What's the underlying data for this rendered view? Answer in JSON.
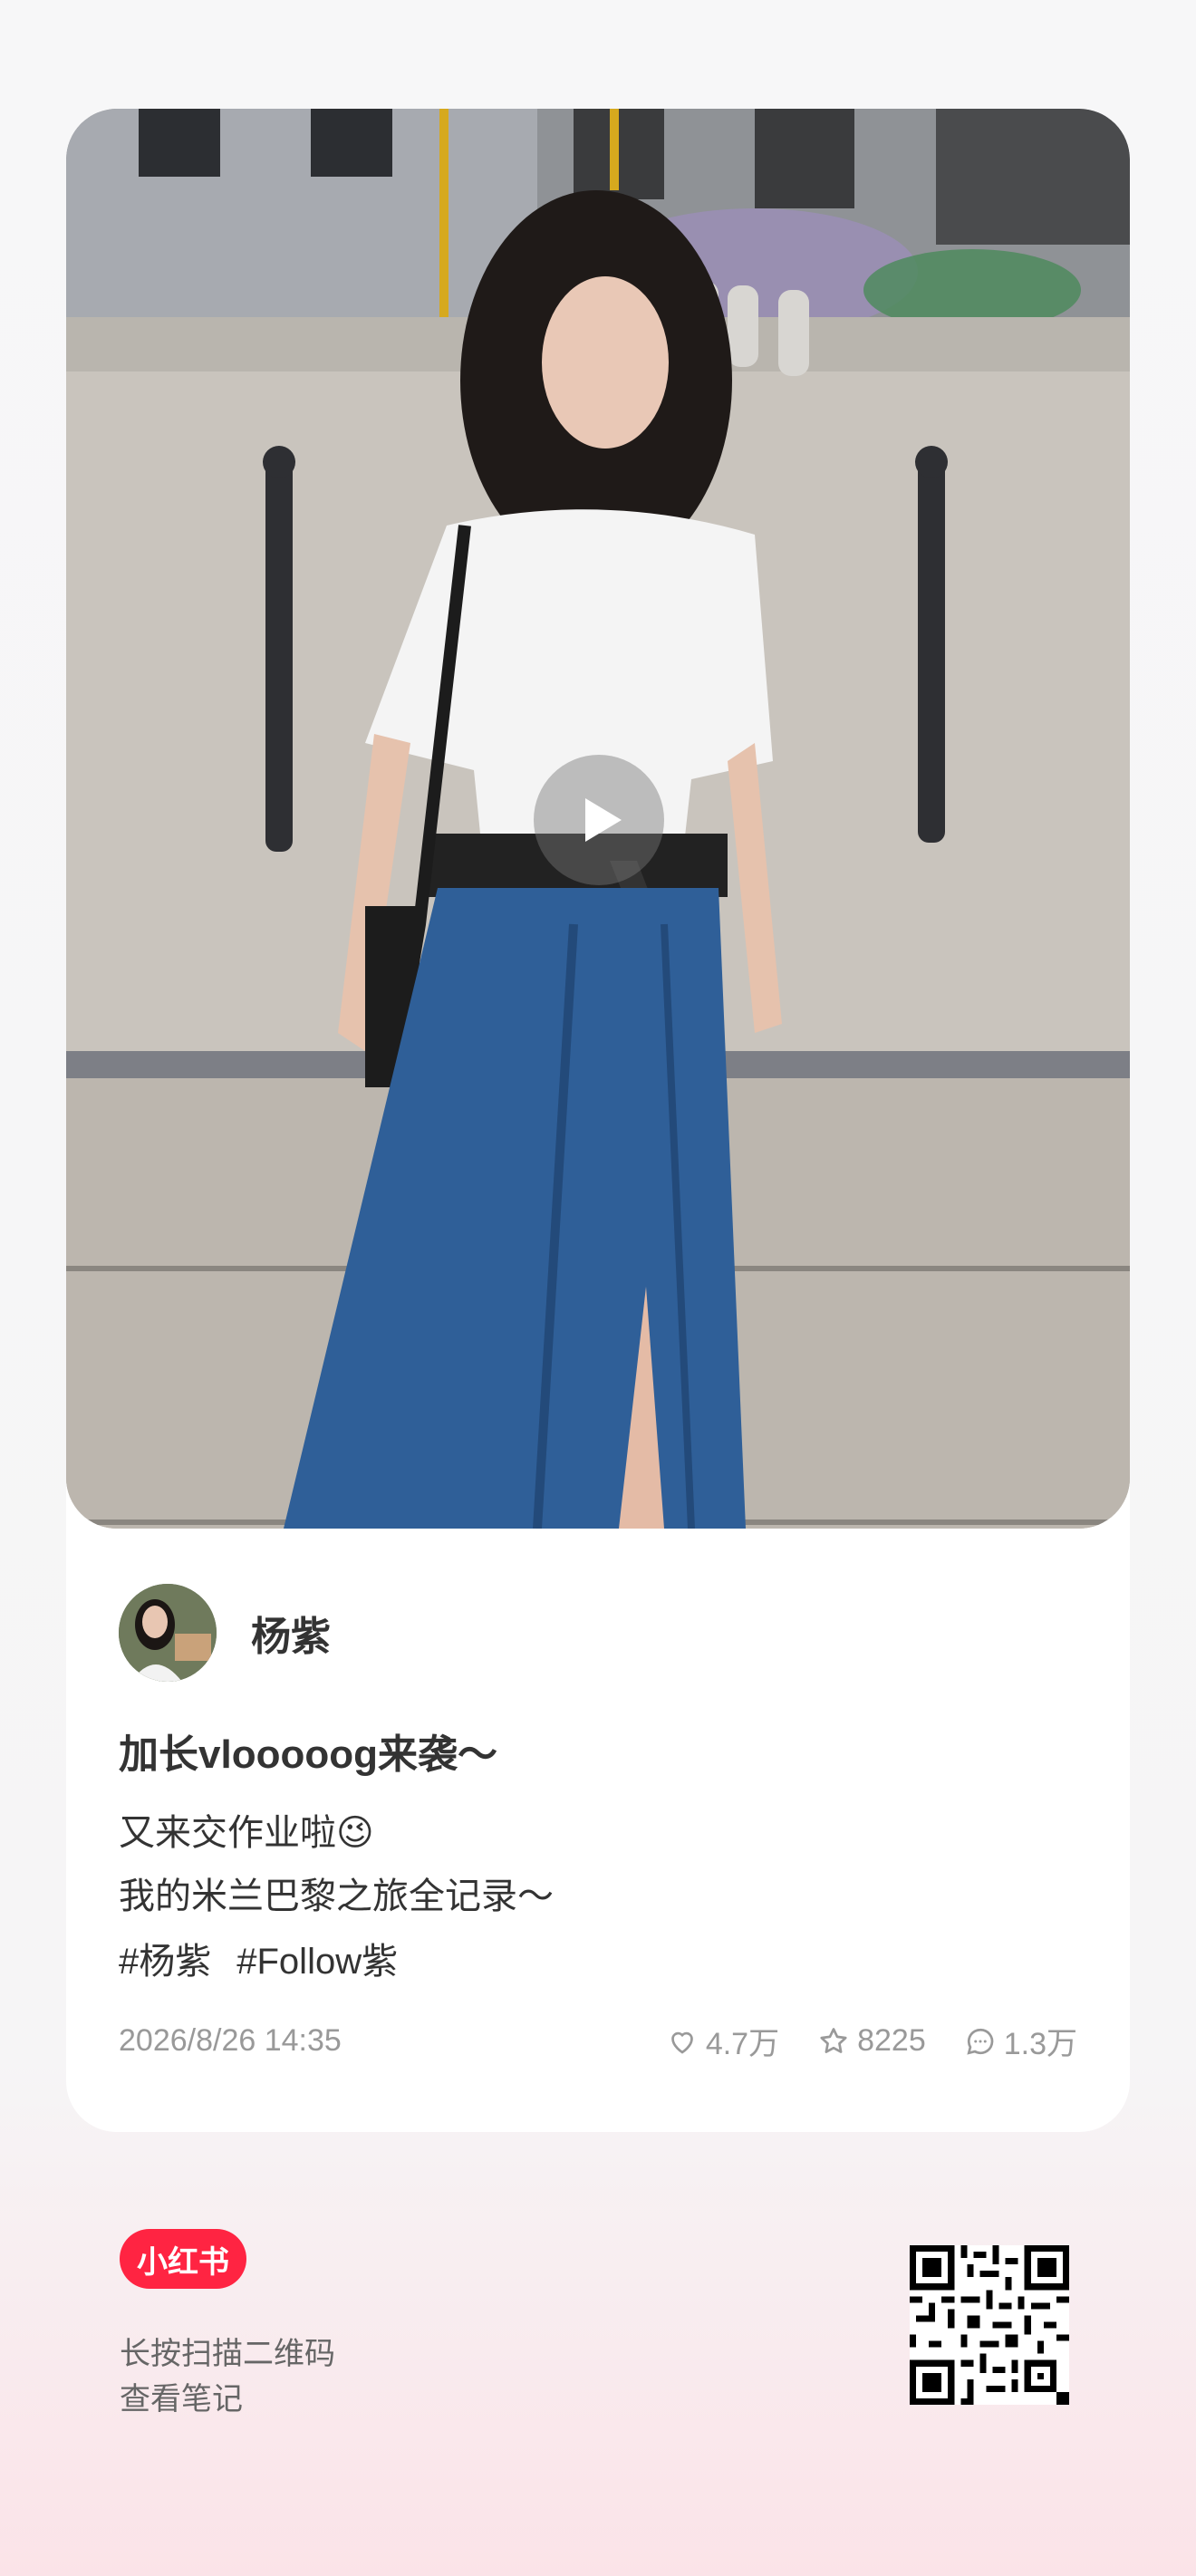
{
  "post": {
    "author": "杨紫",
    "title": "加长vlooooog来袭～",
    "body_line1": "又来交作业啦😉",
    "body_line2": "我的米兰巴黎之旅全记录～",
    "tags": [
      "#杨紫",
      "#Follow紫"
    ],
    "date": "2026/8/26 14:35",
    "likes": "4.7万",
    "favorites": "8225",
    "comments": "1.3万"
  },
  "footer": {
    "brand": "小红书",
    "scan_line1": "长按扫描二维码",
    "scan_line2": "查看笔记"
  },
  "icons": {
    "play": "play-icon",
    "like": "heart-icon",
    "favorite": "star-icon",
    "comment": "comment-icon"
  },
  "colors": {
    "brand": "#ff2442",
    "text": "#333333",
    "meta": "#999999"
  }
}
